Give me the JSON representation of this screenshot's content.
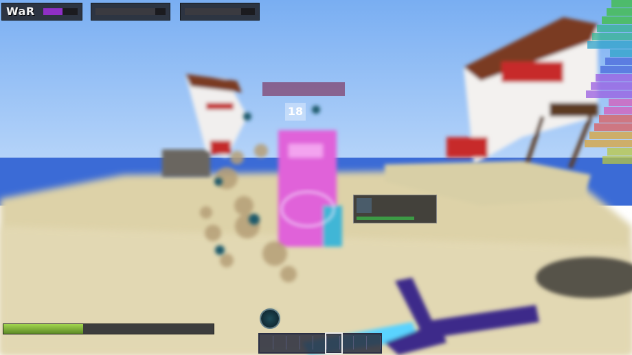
{
  "hud": {
    "player_name": "WaR",
    "health_fraction": 0.55,
    "bar2_fraction": 0.85,
    "bar3_fraction": 0.8
  },
  "target": {
    "name": "",
    "health_fraction": 0.75,
    "overhead_badge": "18"
  },
  "experience": {
    "fill_fraction": 0.38,
    "bar_color": "#8cc63f"
  },
  "hotbar": {
    "slot_count": 9,
    "selected_slot": 5
  },
  "colors": {
    "sky": "#86b7f5",
    "sand": "#e2d7b0",
    "water": "#3d6fd6",
    "target_overlay": "#e254d6",
    "sword_blade": "#5ad3ff",
    "sword_hilt": "#3c2a8a",
    "right_list_gradient": [
      "#3fbf3f",
      "#36b391",
      "#2fa3c9",
      "#4a68d9",
      "#9a5ce0",
      "#d45ab8",
      "#db5b5b",
      "#d8a33a",
      "#b8c640"
    ]
  },
  "icons": {
    "effect": "potion-effect-icon",
    "hotbar": "hotbar-item-icons"
  }
}
